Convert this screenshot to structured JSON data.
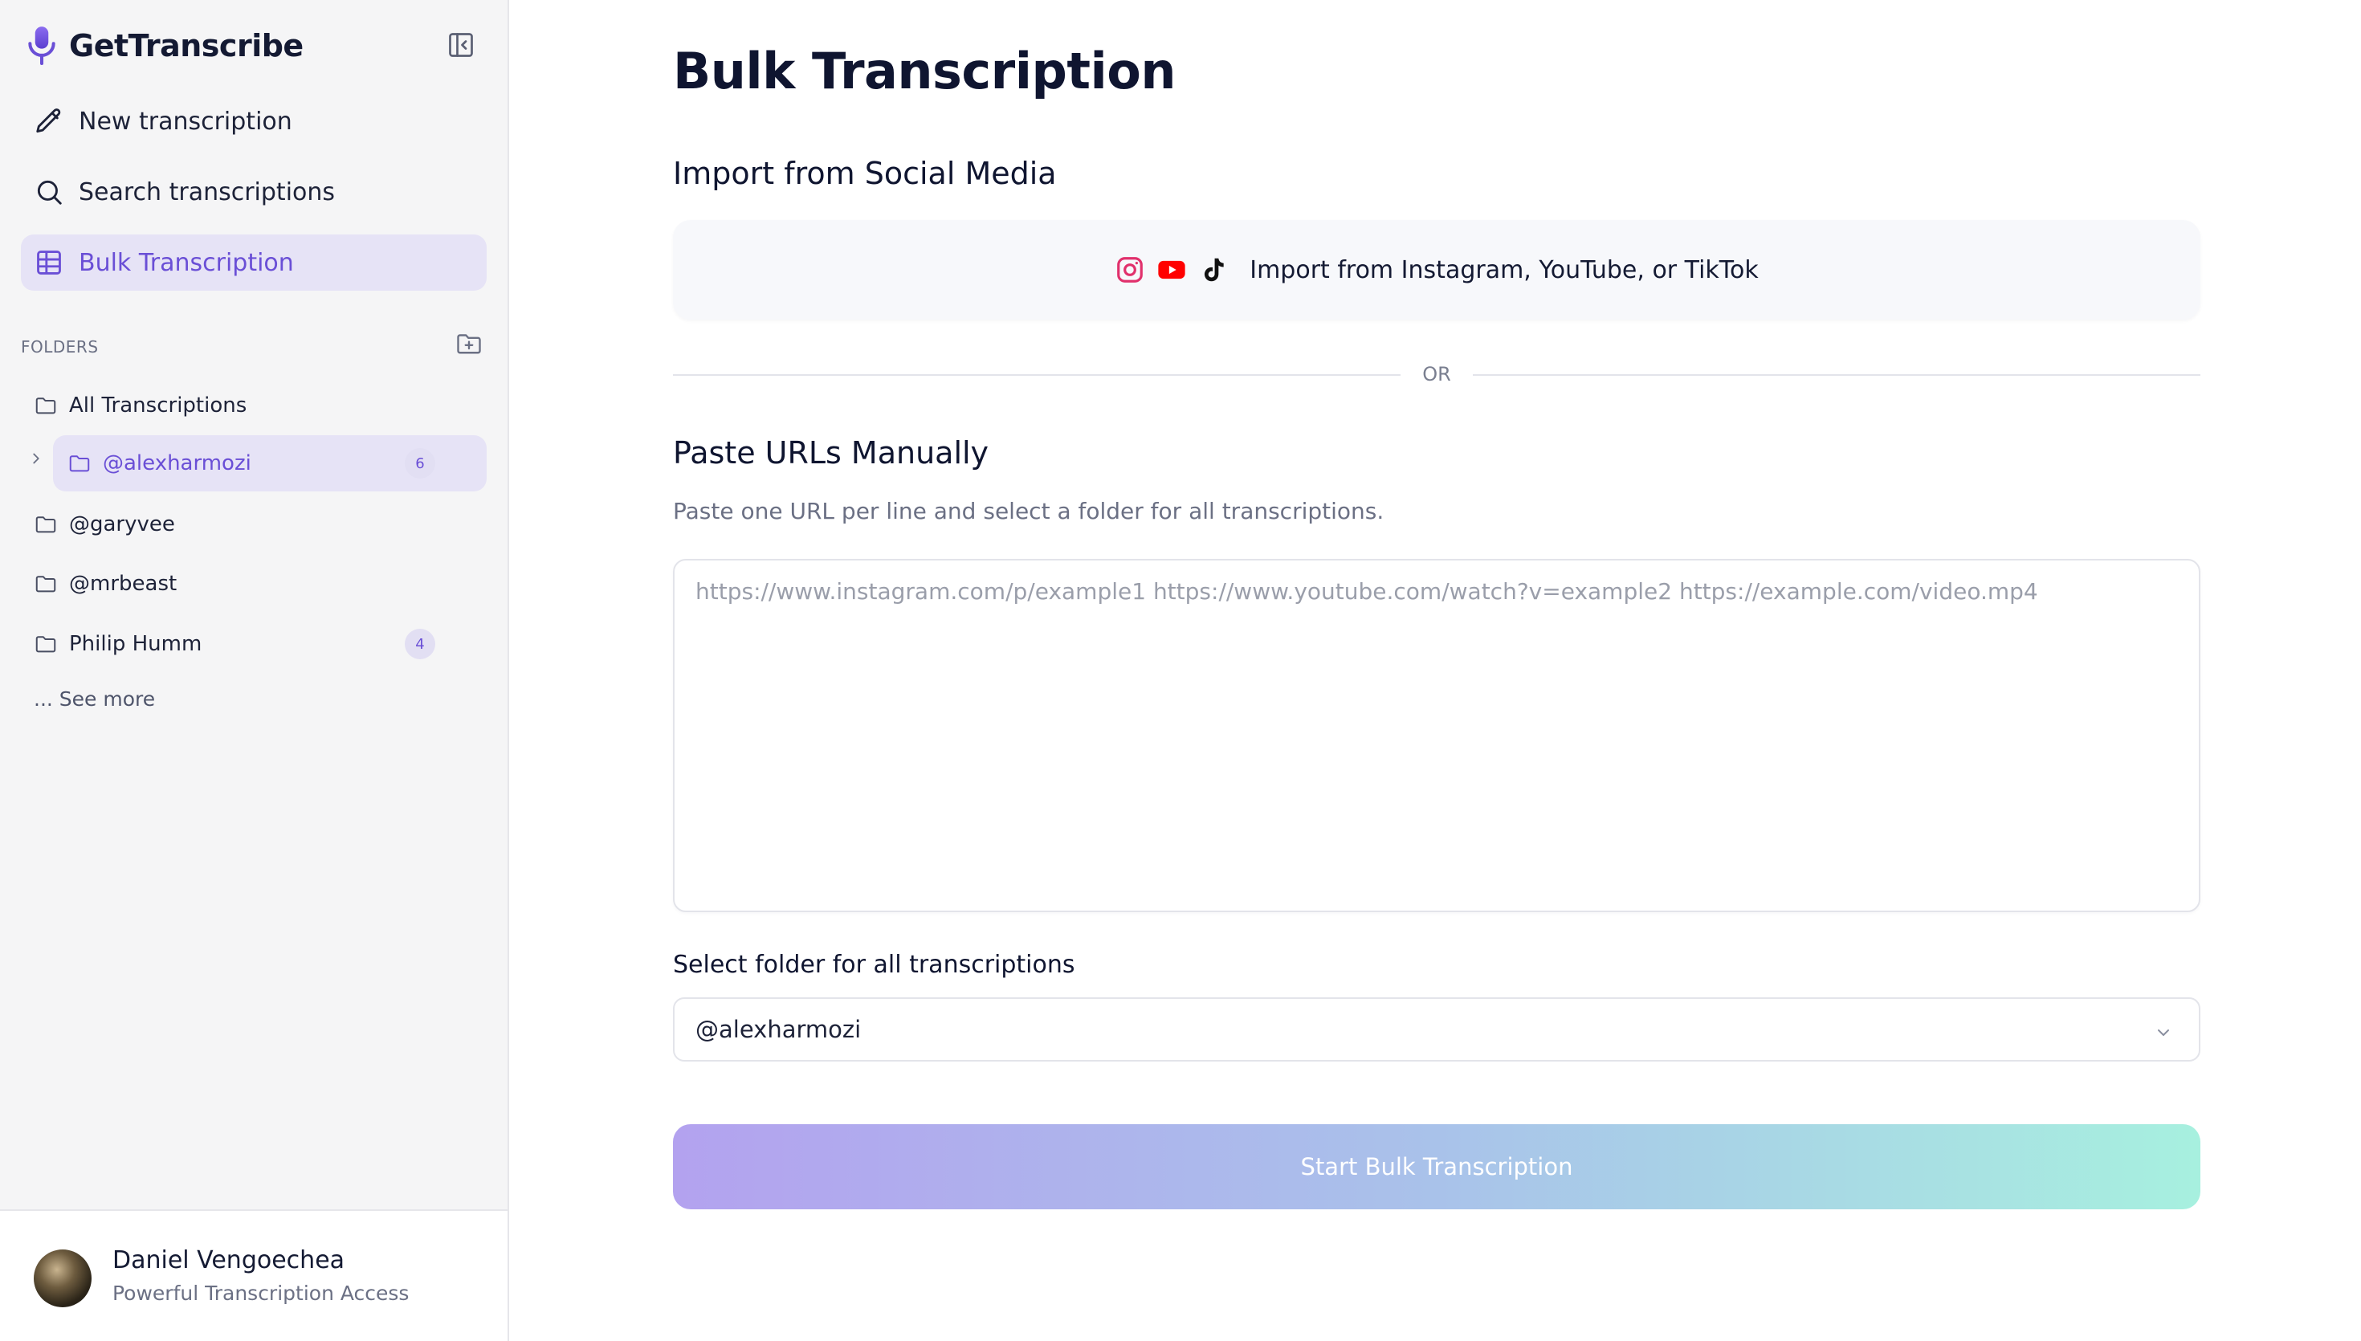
{
  "app": {
    "name": "GetTranscribe"
  },
  "colors": {
    "accent": "#6a4fd6",
    "active_bg": "#e6e3f6",
    "instagram": "#e1306c",
    "youtube": "#ff0000",
    "tiktok": "#111111",
    "gradient_start": "#b3a2ef",
    "gradient_end": "#a7f0df"
  },
  "sidebar": {
    "nav": [
      {
        "label": "New transcription",
        "icon": "pencil-icon"
      },
      {
        "label": "Search transcriptions",
        "icon": "search-icon"
      },
      {
        "label": "Bulk Transcription",
        "icon": "grid-icon",
        "active": true
      }
    ],
    "folders_title": "FOLDERS",
    "folders": [
      {
        "label": "All Transcriptions",
        "icon": "folder-icon"
      },
      {
        "label": "@alexharmozi",
        "icon": "folder-icon",
        "count": "6",
        "active": true
      },
      {
        "label": "@garyvee",
        "icon": "folder-icon"
      },
      {
        "label": "@mrbeast",
        "icon": "folder-icon"
      },
      {
        "label": "Philip Humm",
        "icon": "folder-icon",
        "count": "4"
      }
    ],
    "see_more": "... See more"
  },
  "profile": {
    "name": "Daniel Vengoechea",
    "plan": "Powerful Transcription Access"
  },
  "main": {
    "title": "Bulk Transcription",
    "import_section": {
      "title": "Import from Social Media",
      "button_label": "Import from Instagram, YouTube, or TikTok",
      "icons": [
        "instagram-icon",
        "youtube-icon",
        "tiktok-icon"
      ]
    },
    "divider_text": "OR",
    "manual_section": {
      "title": "Paste URLs Manually",
      "helper": "Paste one URL per line and select a folder for all transcriptions.",
      "value": "",
      "placeholder": "https://www.instagram.com/p/example1 https://www.youtube.com/watch?v=example2 https://example.com/video.mp4"
    },
    "folder_select": {
      "label": "Select folder for all transcriptions",
      "value": "@alexharmozi"
    },
    "start_button": "Start Bulk Transcription"
  }
}
